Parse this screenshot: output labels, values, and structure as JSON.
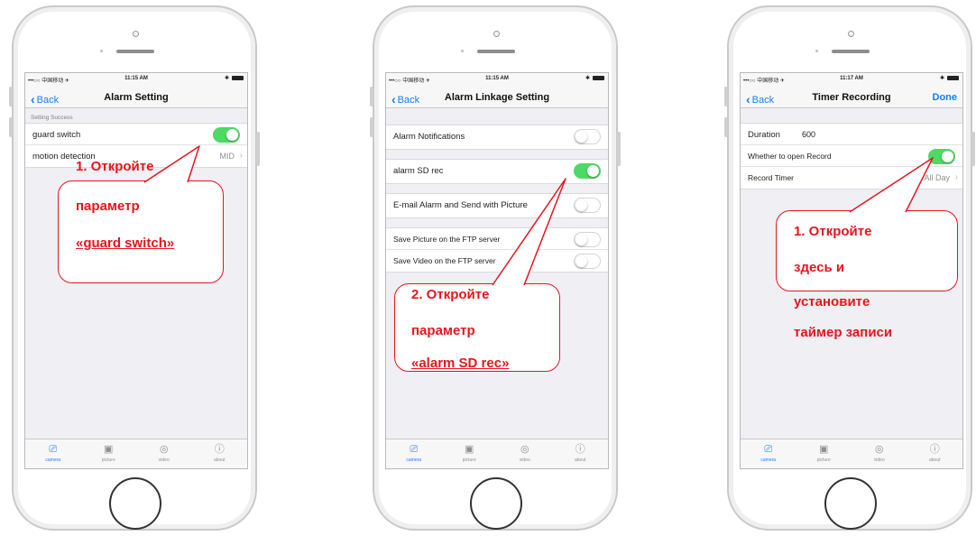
{
  "status_bar": {
    "carrier_p1": "•••○○ 中国移动 ✈",
    "time_p1": "11:15 AM",
    "carrier_p3": "•••○○ 中国移动 ✈",
    "time_p3": "11:17 AM"
  },
  "tabs": [
    {
      "label": "camera",
      "icon": "video-camera-icon",
      "glyph": "⎚"
    },
    {
      "label": "picture",
      "icon": "image-icon",
      "glyph": "▣"
    },
    {
      "label": "video",
      "icon": "video-reel-icon",
      "glyph": "◎"
    },
    {
      "label": "about",
      "icon": "info-icon",
      "glyph": "ⓘ"
    }
  ],
  "screen1": {
    "back": "Back",
    "title": "Alarm Setting",
    "section_header": "Setting Success",
    "rows": [
      {
        "label": "guard switch",
        "toggle_on": true
      },
      {
        "label": "motion detection",
        "value": "MID"
      }
    ],
    "callout": [
      "1. Откройте",
      "параметр",
      "«guard switch»"
    ]
  },
  "screen2": {
    "back": "Back",
    "title": "Alarm Linkage Setting",
    "rows": [
      {
        "label": "Alarm Notifications",
        "toggle_on": false
      },
      {
        "label": "alarm SD rec",
        "toggle_on": true
      },
      {
        "label": "E-mail Alarm and Send with Picture",
        "toggle_on": false
      },
      {
        "label": "Save Picture on the FTP server",
        "toggle_on": false
      },
      {
        "label": "Save Video on the FTP server",
        "toggle_on": false
      }
    ],
    "callout": [
      "2. Откройте",
      "параметр",
      "«alarm SD rec»"
    ]
  },
  "screen3": {
    "back": "Back",
    "title": "Timer Recording",
    "done": "Done",
    "rows": [
      {
        "label": "Duration",
        "value": "600"
      },
      {
        "label": "Whether to open Record",
        "toggle_on": true
      },
      {
        "label": "Record Timer",
        "value": "All Day"
      }
    ],
    "callout": [
      "1. Откройте",
      "здесь и",
      "установите",
      "таймер записи"
    ]
  },
  "colors": {
    "accent": "#147efb",
    "toggle_on": "#4cd964",
    "callout_red": "#e8141d"
  }
}
